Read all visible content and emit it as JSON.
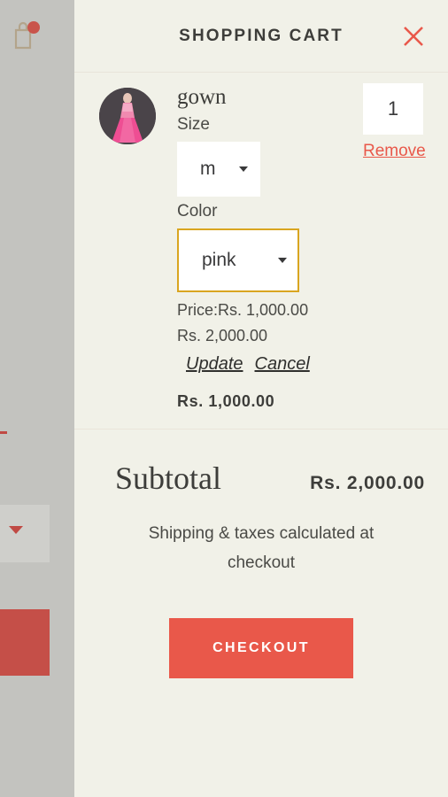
{
  "backdrop": {
    "bag_icon": "shopping-bag-icon",
    "badge": "cart-badge-dot"
  },
  "header": {
    "title": "SHOPPING CART",
    "close_icon": "close-icon"
  },
  "items": [
    {
      "thumbnail_alt": "gown-thumbnail",
      "title": "gown",
      "size_label": "Size",
      "size_value": "m",
      "color_label": "Color",
      "color_value": "pink",
      "price_text": "Price:Rs. 1,000.00 Rs. 2,000.00",
      "update_label": "Update",
      "cancel_label": "Cancel",
      "line_total": "Rs. 1,000.00",
      "quantity": "1",
      "remove_label": "Remove"
    }
  ],
  "footer": {
    "subtotal_label": "Subtotal",
    "subtotal_value": "Rs. 2,000.00",
    "shipping_note": "Shipping & taxes calculated at checkout",
    "checkout_label": "CHECKOUT"
  },
  "colors": {
    "drawer_bg": "#f1f1e8",
    "backdrop": "#c3c3bf",
    "accent_red": "#e9584a",
    "focus_gold": "#d9a520",
    "text_dark": "#3d3d3a"
  }
}
